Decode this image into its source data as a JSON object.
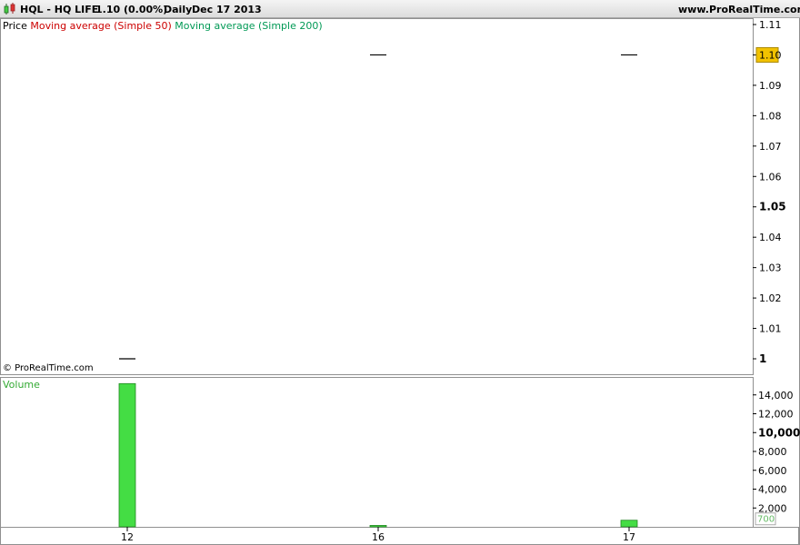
{
  "header": {
    "symbol": "HQL - HQ LIFE",
    "last_price": "1.10 (0.00%)",
    "period": "Daily",
    "date": "Dec 17 2013",
    "website": "www.ProRealTime.com",
    "icon": "candlestick-icon"
  },
  "legend": {
    "price_label": "Price",
    "ma50_label": "Moving average (Simple 50)",
    "ma200_label": "Moving average (Simple 200)",
    "volume_label": "Volume",
    "copyright": "© ProRealTime.com"
  },
  "colors": {
    "ma50": "#cc0000",
    "ma200": "#009955",
    "volume_bar": "#44dd44",
    "volume_border": "#228822",
    "price_badge": "#f2c200",
    "volume_badge_text": "#66bb66"
  },
  "chart_data": [
    {
      "type": "line",
      "title": "Price",
      "categories": [
        "12",
        "16",
        "17"
      ],
      "series": [
        {
          "name": "Price",
          "values": [
            1.0,
            1.1,
            1.1
          ]
        }
      ],
      "ylim": [
        0.997,
        1.113
      ],
      "yticks": [
        1.11,
        1.1,
        1.09,
        1.08,
        1.07,
        1.06,
        1.05,
        1.04,
        1.03,
        1.02,
        1.01,
        1.0
      ],
      "ytick_labels": [
        "1.11",
        "1.10",
        "1.09",
        "1.08",
        "1.07",
        "1.06",
        "1.05",
        "1.04",
        "1.03",
        "1.02",
        "1.01",
        "1"
      ],
      "bold_ticks": [
        "1.05",
        "1"
      ],
      "current_value_label": "1.10",
      "grid": false
    },
    {
      "type": "bar",
      "title": "Volume",
      "categories": [
        "12",
        "16",
        "17"
      ],
      "values": [
        15200,
        150,
        700
      ],
      "ylim": [
        0,
        16000
      ],
      "yticks": [
        14000,
        12000,
        10000,
        8000,
        6000,
        4000,
        2000
      ],
      "ytick_labels": [
        "14,000",
        "12,000",
        "10,000",
        "8,000",
        "6,000",
        "4,000",
        "2,000"
      ],
      "bold_ticks": [
        "10,000"
      ],
      "current_value_label": "700",
      "grid": false
    }
  ]
}
